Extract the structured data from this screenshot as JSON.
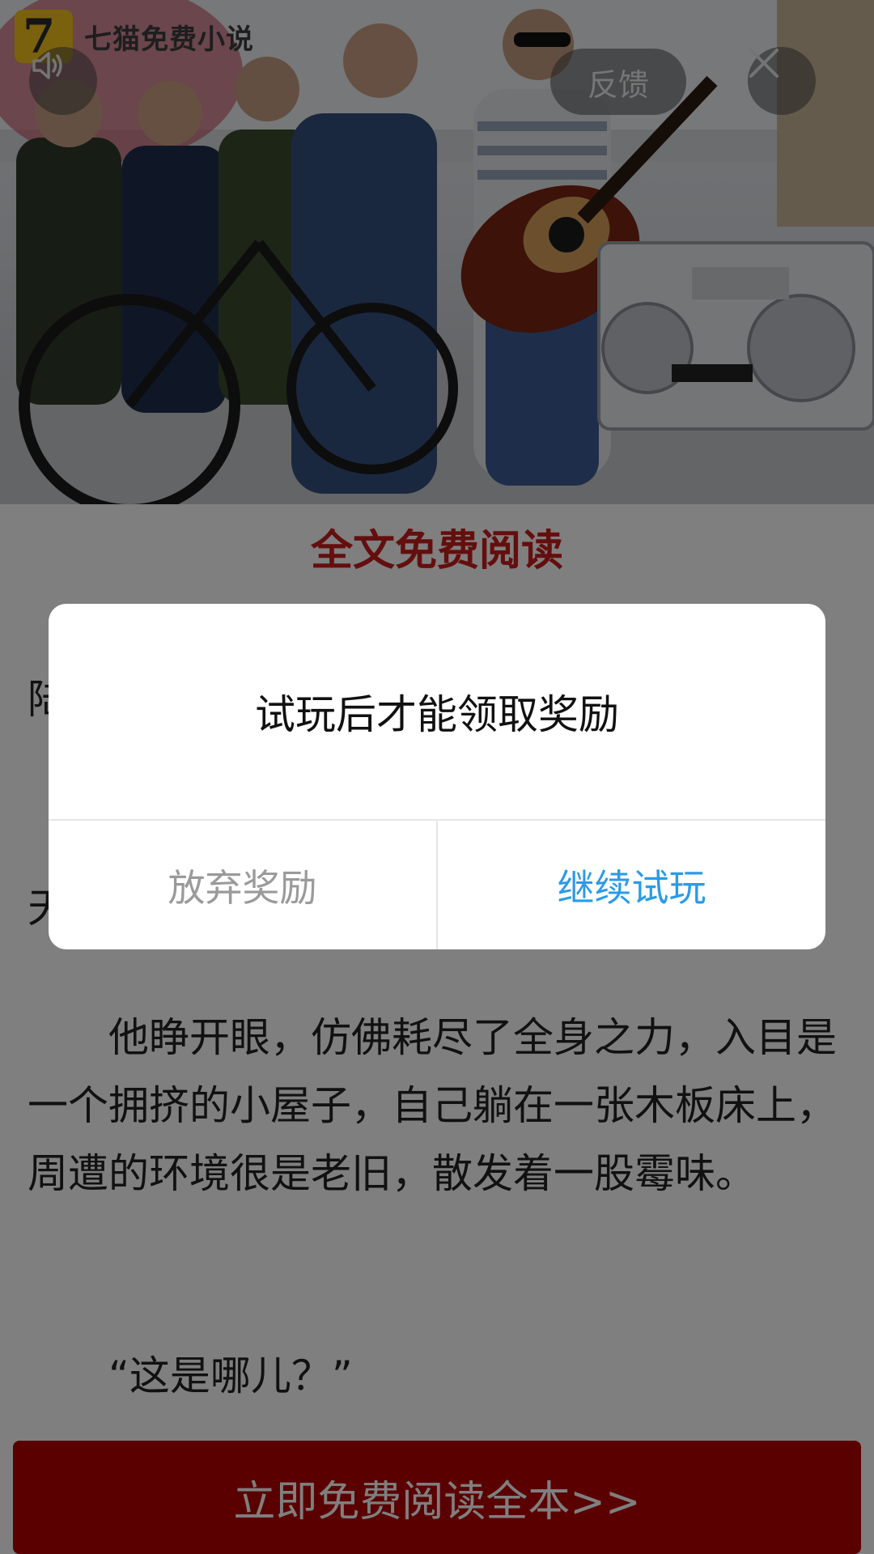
{
  "ad": {
    "brand_name": "七猫免费小说",
    "brand_logo_glyph": "7",
    "feedback_label": "反馈",
    "sound_icon": "speaker-icon",
    "close_icon": "close-icon"
  },
  "article": {
    "heading": "全文免费阅读",
    "para_1": "陆",
    "para_2": "天",
    "body": "他睁开眼，仿佛耗尽了全身之力，入目是一个拥挤的小屋子，自己躺在一张木板床上，周遭的环境很是老旧，散发着一股霉味。",
    "quote": "“这是哪儿？”",
    "cta_label": "立即免费阅读全本>>"
  },
  "dialog": {
    "message": "试玩后才能领取奖励",
    "abandon_label": "放弃奖励",
    "continue_label": "继续试玩"
  },
  "colors": {
    "heading_red": "#c81c1c",
    "cta_red": "#b40000",
    "link_blue": "#2a9be8",
    "muted_gray": "#9a9a9a"
  }
}
